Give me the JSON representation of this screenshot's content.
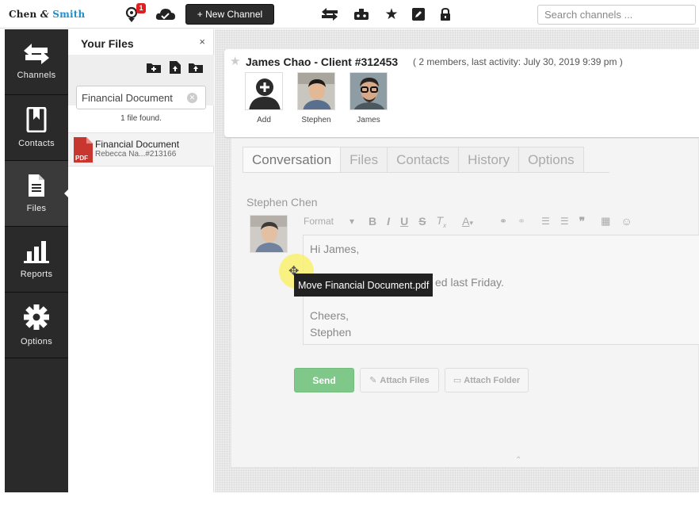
{
  "brand": {
    "part1": "Chen",
    "amp": "&",
    "part2": "Smith",
    "accent": "#1f8fd0"
  },
  "topbar": {
    "notification_count": "1",
    "new_channel_label": "+ New Channel",
    "search_placeholder": "Search channels ..."
  },
  "nav": {
    "items": [
      {
        "label": "Channels",
        "icon": "arrows-icon"
      },
      {
        "label": "Contacts",
        "icon": "bookmark-book-icon"
      },
      {
        "label": "Files",
        "icon": "file-icon",
        "active": true
      },
      {
        "label": "Reports",
        "icon": "bar-chart-icon"
      },
      {
        "label": "Options",
        "icon": "gear-icon"
      }
    ]
  },
  "files_panel": {
    "title": "Your Files",
    "close": "×",
    "filter_value": "Financial Document",
    "found_text": "1 file found.",
    "file": {
      "name": "Financial Document",
      "meta": "Rebecca Na...#213166",
      "type": "PDF"
    }
  },
  "channel": {
    "title": "James Chao - Client #312453",
    "subtitle": "( 2 members, last activity: July 30, 2019 9:39 pm )",
    "members": [
      {
        "label": "Add"
      },
      {
        "label": "Stephen"
      },
      {
        "label": "James"
      }
    ]
  },
  "conversation": {
    "tabs": [
      "Conversation",
      "Files",
      "Contacts",
      "History",
      "Options"
    ],
    "active_tab": "Conversation",
    "author": "Stephen Chen",
    "toolbar_format": "Format",
    "message_lines": [
      "Hi James,",
      "ed last Friday.",
      "Cheers,",
      "Stephen"
    ],
    "send_label": "Send",
    "attach_files_label": "Attach Files",
    "attach_folder_label": "Attach Folder"
  },
  "drag": {
    "tooltip": "Move Financial Document.pdf"
  },
  "colors": {
    "send_green": "#7fc88a",
    "nav_dark": "#2a2a2a",
    "badge_red": "#e02020"
  }
}
